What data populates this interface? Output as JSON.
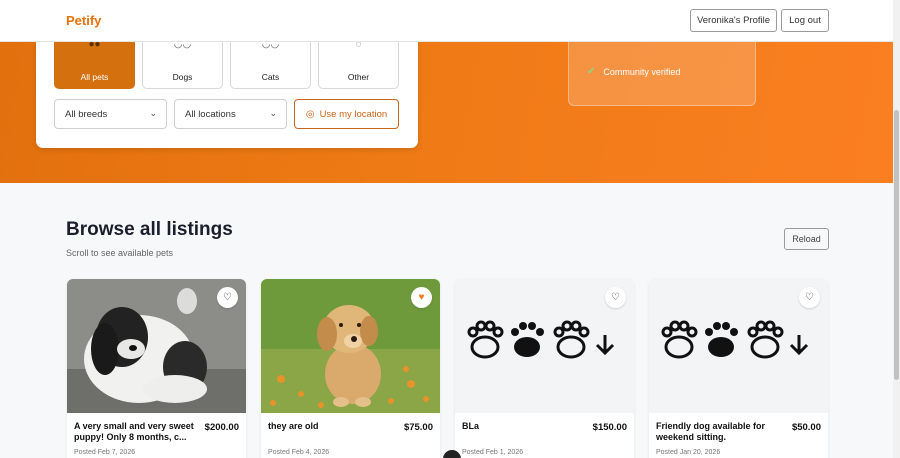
{
  "header": {
    "logo": "Petify",
    "profile_label": "Veronika's Profile",
    "logout_label": "Log out"
  },
  "filters": {
    "pet_types": [
      {
        "label": "All pets",
        "icon": "paw-group-icon",
        "active": true
      },
      {
        "label": "Dogs",
        "icon": "dog-icon",
        "active": false
      },
      {
        "label": "Cats",
        "icon": "cat-icon",
        "active": false
      },
      {
        "label": "Other",
        "icon": "rabbit-icon",
        "active": false
      }
    ],
    "breed_select": "All breeds",
    "location_select": "All locations",
    "use_location_label": "Use my location"
  },
  "info": {
    "community_verified": "Community verified"
  },
  "browse": {
    "title": "Browse all listings",
    "subtitle": "Scroll to see available pets",
    "reload_label": "Reload"
  },
  "listings": [
    {
      "title": "A very small and very sweet puppy! Only 8 months, c...",
      "price": "$200.00",
      "posted": "Posted Feb 7, 2026",
      "favorited": false,
      "image": "shih-tzu-photo"
    },
    {
      "title": "they are old",
      "price": "$75.00",
      "posted": "Posted Feb 4, 2026",
      "favorited": true,
      "image": "golden-puppy-photo"
    },
    {
      "title": "BLa",
      "price": "$150.00",
      "posted": "Posted Feb 1, 2026",
      "favorited": false,
      "image": "paw-placeholder"
    },
    {
      "title": "Friendly dog available for weekend sitting.",
      "price": "$50.00",
      "posted": "Posted Jan 20, 2026",
      "favorited": false,
      "image": "paw-placeholder"
    }
  ],
  "colors": {
    "brand": "#e8710a",
    "hero_start": "#e2700d",
    "hero_end": "#fb7f21",
    "favorite_active": "#f07b21"
  }
}
